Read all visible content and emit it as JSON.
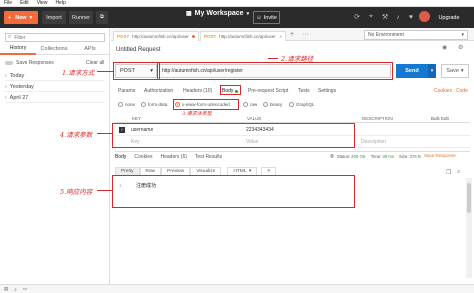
{
  "menu": [
    "File",
    "Edit",
    "View",
    "Help"
  ],
  "toolbar": {
    "new_label": "New",
    "import_label": "Import",
    "runner_label": "Runner",
    "workspace_label": "My Workspace",
    "invite_label": "Invite",
    "upgrade_label": "Upgrade"
  },
  "sidebar": {
    "filter_placeholder": "Filter",
    "tabs": [
      "History",
      "Collections",
      "APIs"
    ],
    "save_responses_label": "Save Responses",
    "clear_all_label": "Clear all",
    "groups": [
      "Today",
      "Yesterday",
      "April 27"
    ]
  },
  "request_tabs": [
    {
      "method": "POST",
      "url": "http://autumnfish.cn/api/user"
    },
    {
      "method": "POST",
      "url": "http://autumnfish.cn/api/user"
    }
  ],
  "environment": "No Environment",
  "request": {
    "title": "Untitled Request",
    "method": "POST",
    "url": "http://autumnfish.cn/api/user/register",
    "send_label": "Send",
    "save_label": "Save"
  },
  "subtabs": [
    "Params",
    "Authorization",
    "Headers (10)",
    "Body",
    "Pre-request Script",
    "Tests",
    "Settings"
  ],
  "cookies_label": "Cookies",
  "code_label": "Code",
  "body_types": [
    "none",
    "form-data",
    "x-www-form-urlencoded",
    "raw",
    "binary",
    "GraphQL"
  ],
  "body_type_selected": "x-www-form-urlencoded",
  "kv_table": {
    "headers": [
      "KEY",
      "VALUE",
      "DESCRIPTION"
    ],
    "bulk_edit": "Bulk Edit",
    "rows": [
      {
        "key": "username",
        "value": "2234343434",
        "description": "",
        "checked": true
      },
      {
        "key": "Key",
        "value": "Value",
        "description": "Description",
        "checked": false
      }
    ]
  },
  "response": {
    "tabs": [
      "Body",
      "Cookies",
      "Headers (6)",
      "Test Results"
    ],
    "status_label": "Status:",
    "status_value": "200 OK",
    "time_label": "Time:",
    "time_value": "39 ms",
    "size_label": "Size:",
    "size_value": "376 B",
    "save_response_label": "Save Response",
    "view_buttons": [
      "Pretty",
      "Raw",
      "Preview",
      "Visualize"
    ],
    "format": "HTML",
    "line_number": "1",
    "body_text": "注册成功"
  },
  "annotations": {
    "method_note": "1.请求方式",
    "url_note": "2.请求路径",
    "body_type_note": "3.请求体类型",
    "params_note": "4.请求参数",
    "response_note": "5.响应内容"
  },
  "colors": {
    "brand_orange": "#f26b3a",
    "send_blue": "#1679d1",
    "annotation_red": "#d42a2a"
  }
}
